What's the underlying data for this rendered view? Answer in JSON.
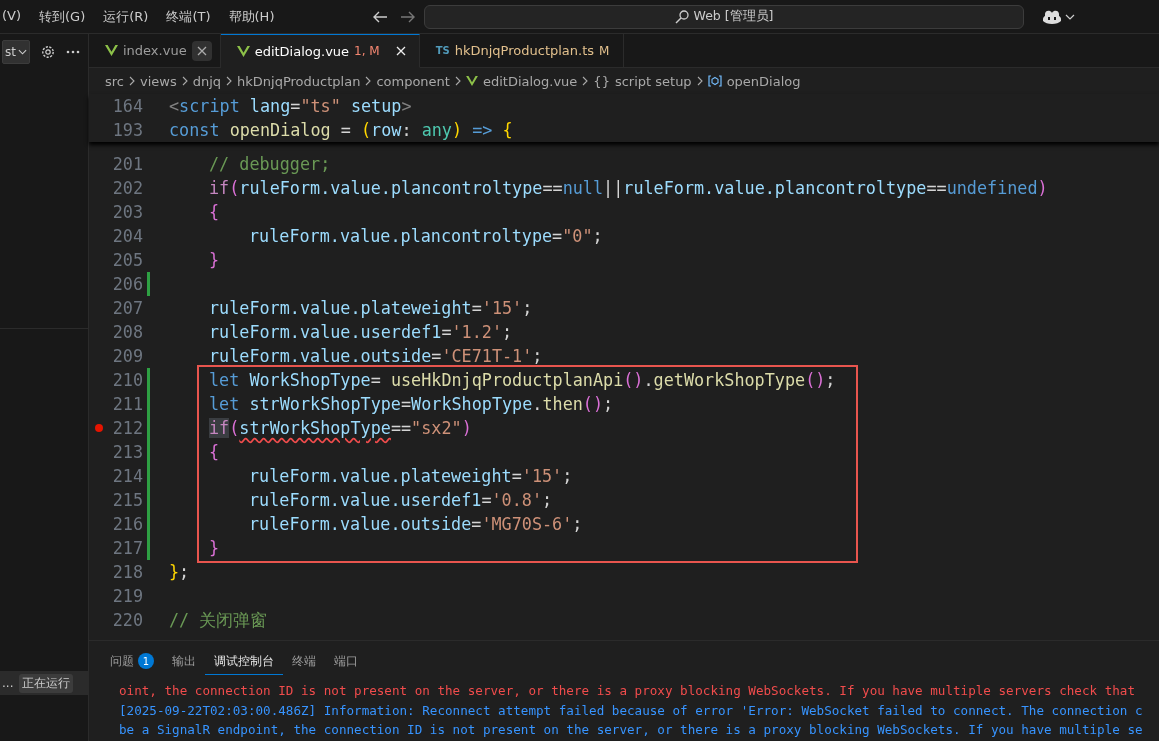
{
  "menu_bar": {
    "items": [
      "(V)",
      "转到(G)",
      "运行(R)",
      "终端(T)",
      "帮助(H)"
    ]
  },
  "command_center": {
    "label": "Web [管理员]"
  },
  "sidebar": {
    "dropdown": {
      "value": "st"
    },
    "running_item": {
      "label": "...",
      "badge": "正在运行"
    }
  },
  "tabs": [
    {
      "label": "index.vue",
      "icon": {
        "kind": "vue"
      },
      "has_errors": false,
      "modified": false,
      "selected": false,
      "close_visible": true,
      "close_hovered": true
    },
    {
      "label": "editDialog.vue",
      "icon": {
        "kind": "vue"
      },
      "decoration": "1, M",
      "has_errors": true,
      "modified": true,
      "selected": true,
      "close_visible": true,
      "close_hovered": false
    },
    {
      "label": "hkDnjqProductplan.ts",
      "icon": {
        "kind": "ts",
        "text": "TS"
      },
      "decoration": "M",
      "has_errors": false,
      "modified": true,
      "selected": false,
      "close_visible": false
    }
  ],
  "breadcrumb": [
    {
      "label": "src"
    },
    {
      "label": "views"
    },
    {
      "label": "dnjq"
    },
    {
      "label": "hkDnjqProductplan"
    },
    {
      "label": "component"
    },
    {
      "label": "editDialog.vue",
      "icon": {
        "kind": "vue"
      }
    },
    {
      "label": "script setup",
      "icon": {
        "kind": "text",
        "text": "{}"
      }
    },
    {
      "label": "openDialog",
      "icon": {
        "kind": "symbol"
      }
    }
  ],
  "editor": {
    "sticky_lines": [
      {
        "number": "164",
        "tokens": [
          {
            "kind": "tag",
            "t": "<"
          },
          {
            "kind": "kw",
            "t": "script"
          },
          {
            "kind": "var",
            "t": " lang"
          },
          {
            "kind": "op",
            "t": "="
          },
          {
            "kind": "str",
            "t": "\"ts\""
          },
          {
            "kind": "var",
            "t": " setup"
          },
          {
            "kind": "tag",
            "t": ">"
          }
        ]
      },
      {
        "number": "193",
        "tokens": [
          {
            "kind": "kw",
            "t": "const"
          },
          {
            "kind": "fn",
            "t": " openDialog"
          },
          {
            "kind": "op",
            "t": " = "
          },
          {
            "kind": "b1",
            "t": "("
          },
          {
            "kind": "var",
            "t": "row"
          },
          {
            "kind": "op",
            "t": ": "
          },
          {
            "kind": "type",
            "t": "any"
          },
          {
            "kind": "b1",
            "t": ")"
          },
          {
            "kind": "kw",
            "t": " =>"
          },
          {
            "kind": "b1",
            "t": " {"
          }
        ]
      }
    ],
    "blocks": [
      {
        "boxed": false,
        "lines": [
          {
            "number": "201",
            "kind": "inner",
            "modified": false,
            "breakpoint": false,
            "tokens": [
              {
                "kind": "cmt",
                "t": "// debugger;"
              }
            ]
          },
          {
            "number": "202",
            "kind": "inner",
            "modified": false,
            "breakpoint": false,
            "tokens": [
              {
                "kind": "ctrl",
                "t": "if"
              },
              {
                "kind": "b2",
                "t": "("
              },
              {
                "kind": "var",
                "t": "ruleForm.value.plancontroltype"
              },
              {
                "kind": "op",
                "t": "=="
              },
              {
                "kind": "kw",
                "t": "null"
              },
              {
                "kind": "op",
                "t": "||"
              },
              {
                "kind": "var",
                "t": "ruleForm.value.plancontroltype"
              },
              {
                "kind": "op",
                "t": "=="
              },
              {
                "kind": "kw",
                "t": "undefined"
              },
              {
                "kind": "b2",
                "t": ")"
              }
            ]
          },
          {
            "number": "203",
            "kind": "inner",
            "modified": false,
            "breakpoint": false,
            "tokens": [
              {
                "kind": "b2",
                "t": "{"
              }
            ]
          },
          {
            "number": "204",
            "kind": "inner2",
            "modified": false,
            "breakpoint": false,
            "tokens": [
              {
                "kind": "var",
                "t": "ruleForm.value.plancontroltype"
              },
              {
                "kind": "op",
                "t": "="
              },
              {
                "kind": "str",
                "t": "\"0\""
              },
              {
                "kind": "op",
                "t": ";"
              }
            ]
          },
          {
            "number": "205",
            "kind": "inner",
            "modified": false,
            "breakpoint": false,
            "tokens": [
              {
                "kind": "b2",
                "t": "}"
              }
            ]
          },
          {
            "number": "206",
            "modified": true,
            "breakpoint": false
          },
          {
            "number": "207",
            "kind": "inner",
            "modified": false,
            "breakpoint": false,
            "tokens": [
              {
                "kind": "var",
                "t": "ruleForm.value.plateweight"
              },
              {
                "kind": "op",
                "t": "="
              },
              {
                "kind": "str",
                "t": "'15'"
              },
              {
                "kind": "op",
                "t": ";"
              }
            ]
          },
          {
            "number": "208",
            "kind": "inner",
            "modified": false,
            "breakpoint": false,
            "tokens": [
              {
                "kind": "var",
                "t": "ruleForm.value.userdef1"
              },
              {
                "kind": "op",
                "t": "="
              },
              {
                "kind": "str",
                "t": "'1.2'"
              },
              {
                "kind": "op",
                "t": ";"
              }
            ]
          },
          {
            "number": "209",
            "kind": "inner",
            "modified": false,
            "breakpoint": false,
            "tokens": [
              {
                "kind": "var",
                "t": "ruleForm.value.outside"
              },
              {
                "kind": "op",
                "t": "="
              },
              {
                "kind": "str",
                "t": "'CE71T-1'"
              },
              {
                "kind": "op",
                "t": ";"
              }
            ]
          }
        ]
      },
      {
        "boxed": true,
        "lines": [
          {
            "number": "210",
            "kind": "inner",
            "modified": true,
            "breakpoint": false,
            "tokens": [
              {
                "kind": "kw",
                "t": "let"
              },
              {
                "kind": "var",
                "t": " WorkShopType"
              },
              {
                "kind": "op",
                "t": "= "
              },
              {
                "kind": "fn",
                "t": "useHkDnjqProductplanApi"
              },
              {
                "kind": "b2",
                "t": "()"
              },
              {
                "kind": "op",
                "t": "."
              },
              {
                "kind": "fn",
                "t": "getWorkShopType"
              },
              {
                "kind": "b2",
                "t": "()"
              },
              {
                "kind": "op",
                "t": ";"
              }
            ]
          },
          {
            "number": "211",
            "kind": "inner",
            "modified": true,
            "breakpoint": false,
            "tokens": [
              {
                "kind": "kw",
                "t": "let"
              },
              {
                "kind": "var",
                "t": " strWorkShopType"
              },
              {
                "kind": "op",
                "t": "="
              },
              {
                "kind": "var",
                "t": "WorkShopType"
              },
              {
                "kind": "op",
                "t": "."
              },
              {
                "kind": "fn",
                "t": "then"
              },
              {
                "kind": "b2",
                "t": "()"
              },
              {
                "kind": "op",
                "t": ";"
              }
            ]
          },
          {
            "number": "212",
            "kind": "inner",
            "modified": true,
            "breakpoint": true,
            "tokens": [
              {
                "kind": "ctrl_hl",
                "t": "if"
              },
              {
                "kind": "b2",
                "t": "("
              },
              {
                "kind": "var_err",
                "t": "strWorkShopType"
              },
              {
                "kind": "op",
                "t": "=="
              },
              {
                "kind": "str",
                "t": "\"sx2\""
              },
              {
                "kind": "b2",
                "t": ")"
              }
            ]
          },
          {
            "number": "213",
            "kind": "inner",
            "modified": true,
            "breakpoint": false,
            "tokens": [
              {
                "kind": "b2",
                "t": "{"
              }
            ]
          },
          {
            "number": "214",
            "kind": "inner2",
            "modified": true,
            "breakpoint": false,
            "tokens": [
              {
                "kind": "var",
                "t": "ruleForm.value.plateweight"
              },
              {
                "kind": "op",
                "t": "="
              },
              {
                "kind": "str",
                "t": "'15'"
              },
              {
                "kind": "op",
                "t": ";"
              }
            ]
          },
          {
            "number": "215",
            "kind": "inner2",
            "modified": true,
            "breakpoint": false,
            "tokens": [
              {
                "kind": "var",
                "t": "ruleForm.value.userdef1"
              },
              {
                "kind": "op",
                "t": "="
              },
              {
                "kind": "str",
                "t": "'0.8'"
              },
              {
                "kind": "op",
                "t": ";"
              }
            ]
          },
          {
            "number": "216",
            "kind": "inner2",
            "modified": true,
            "breakpoint": false,
            "tokens": [
              {
                "kind": "var",
                "t": "ruleForm.value.outside"
              },
              {
                "kind": "op",
                "t": "="
              },
              {
                "kind": "str",
                "t": "'MG70S-6'"
              },
              {
                "kind": "op",
                "t": ";"
              }
            ]
          },
          {
            "number": "217",
            "kind": "inner",
            "modified": true,
            "breakpoint": false,
            "tokens": [
              {
                "kind": "b2",
                "t": "}"
              }
            ]
          }
        ]
      },
      {
        "boxed": false,
        "lines": [
          {
            "number": "218",
            "kind": "top",
            "modified": false,
            "breakpoint": false,
            "tokens": [
              {
                "kind": "b1",
                "t": "}"
              },
              {
                "kind": "op",
                "t": ";"
              }
            ]
          },
          {
            "number": "219",
            "modified": false,
            "breakpoint": false
          },
          {
            "number": "220",
            "kind": "top",
            "modified": false,
            "breakpoint": false,
            "tokens": [
              {
                "kind": "cmt",
                "t": "// 关闭弹窗"
              }
            ]
          }
        ]
      }
    ]
  },
  "panel": {
    "tabs": [
      {
        "label": "问题",
        "badge": "1",
        "selected": false
      },
      {
        "label": "输出",
        "selected": false
      },
      {
        "label": "调试控制台",
        "selected": true
      },
      {
        "label": "终端",
        "selected": false
      },
      {
        "label": "端口",
        "selected": false
      }
    ],
    "console": [
      {
        "kind": "error",
        "text": "oint, the connection ID is not present on the server, or there is a proxy blocking WebSockets. If you have multiple servers check that"
      },
      {
        "kind": "info",
        "text": "[2025-09-22T02:03:00.486Z] Information: Reconnect attempt failed because of error 'Error: WebSocket failed to connect. The connection c"
      },
      {
        "kind": "info",
        "text": "be a SignalR endpoint, the connection ID is not present on the server, or there is a proxy blocking WebSockets. If you have multiple se"
      }
    ]
  }
}
